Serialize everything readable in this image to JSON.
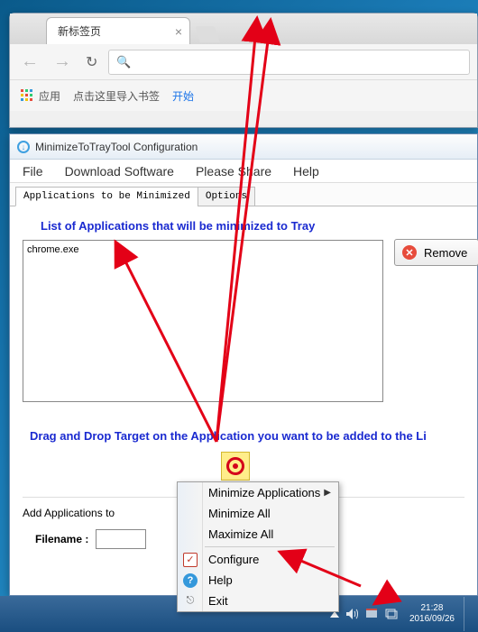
{
  "chrome": {
    "tab_title": "新标签页",
    "apps_label": "应用",
    "import_text": "点击这里导入书签",
    "start_link": "开始"
  },
  "config": {
    "window_title": "MinimizeToTrayTool Configuration",
    "menu": {
      "file": "File",
      "download": "Download Software",
      "share": "Please Share",
      "help": "Help"
    },
    "tabs": {
      "apps": "Applications to be Minimized",
      "options": "Options"
    },
    "list_title": "List of Applications that will be minimized to Tray",
    "list_items": [
      "chrome.exe"
    ],
    "remove_label": "Remove",
    "drag_title": "Drag and Drop Target on the Application you want to be added to the Li",
    "add_label": "Add Applications to",
    "filename_label": "Filename :"
  },
  "context_menu": {
    "minimize_apps": "Minimize Applications",
    "minimize_all": "Minimize All",
    "maximize_all": "Maximize All",
    "configure": "Configure",
    "help": "Help",
    "exit": "Exit"
  },
  "taskbar": {
    "time": "21:28",
    "date": "2016/09/26"
  }
}
